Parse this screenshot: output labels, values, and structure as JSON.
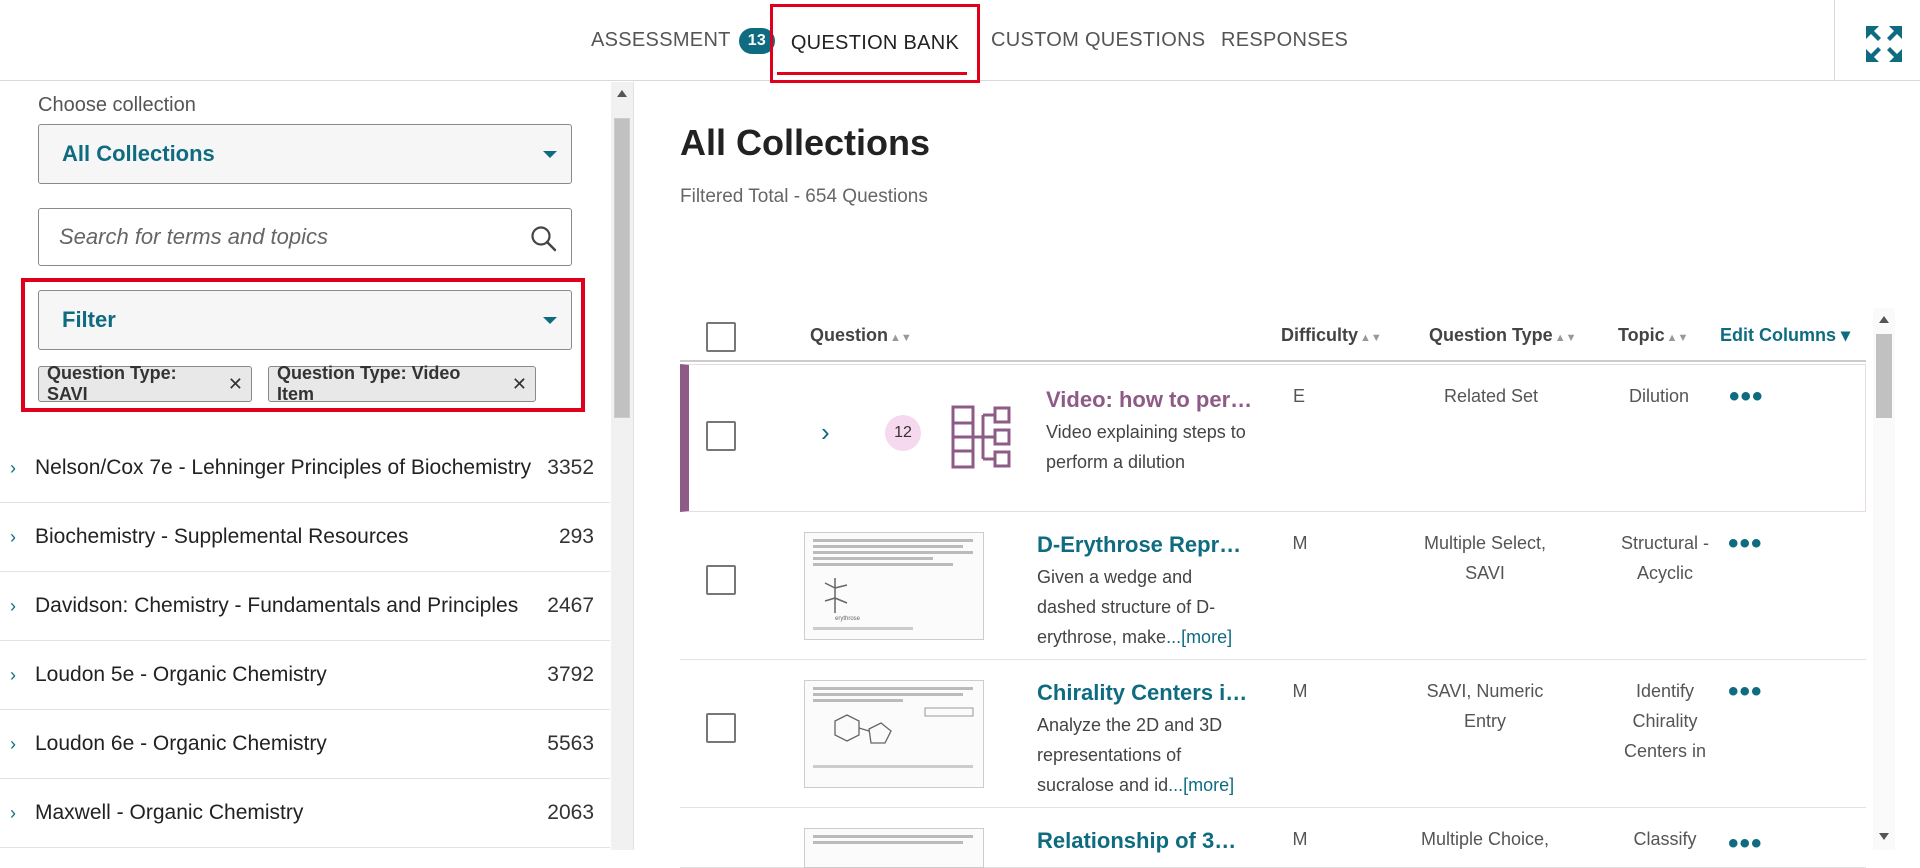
{
  "nav": {
    "tabs": [
      {
        "label": "ASSESSMENT",
        "badge": "13"
      },
      {
        "label": "QUESTION BANK"
      },
      {
        "label": "CUSTOM QUESTIONS"
      },
      {
        "label": "RESPONSES"
      }
    ],
    "expand_icon": "expand-arrows-icon"
  },
  "sidebar": {
    "choose_label": "Choose collection",
    "collection_select": "All Collections",
    "search_placeholder": "Search for terms and topics",
    "filter_label": "Filter",
    "chips": [
      "Question Type: SAVI",
      "Question Type: Video Item"
    ],
    "collections": [
      {
        "name": "Nelson/Cox 7e - Lehninger Principles of Biochemistry",
        "count": "3352"
      },
      {
        "name": "Biochemistry - Supplemental Resources",
        "count": "293"
      },
      {
        "name": "Davidson: Chemistry - Fundamentals and Principles",
        "count": "2467"
      },
      {
        "name": "Loudon 5e - Organic Chemistry",
        "count": "3792"
      },
      {
        "name": "Loudon 6e - Organic Chemistry",
        "count": "5563"
      },
      {
        "name": "Maxwell - Organic Chemistry",
        "count": "2063"
      }
    ]
  },
  "main": {
    "title": "All Collections",
    "subtitle": "Filtered Total - 654 Questions",
    "columns": {
      "question": "Question",
      "difficulty": "Difficulty",
      "question_type": "Question Type",
      "topic": "Topic",
      "edit_columns": "Edit Columns"
    },
    "rows": [
      {
        "count": "12",
        "title": "Video: how to per…",
        "desc": "Video explaining steps to perform a dilution",
        "difficulty": "E",
        "type": "Related Set",
        "topic": "Dilution"
      },
      {
        "title": "D-Erythrose Repr…",
        "desc": "Given a wedge and dashed structure of D-erythrose, make",
        "more": "...[more]",
        "difficulty": "M",
        "type": "Multiple Select, SAVI",
        "topic": "Structural - Acyclic"
      },
      {
        "title": "Chirality Centers i…",
        "desc": "Analyze the 2D and 3D representations of sucralose and id",
        "more": "...[more]",
        "difficulty": "M",
        "type": "SAVI, Numeric Entry",
        "topic": "Identify Chirality Centers in"
      },
      {
        "title": "Relationship of 3…",
        "difficulty": "M",
        "type": "Multiple Choice,",
        "topic": "Classify"
      }
    ]
  }
}
